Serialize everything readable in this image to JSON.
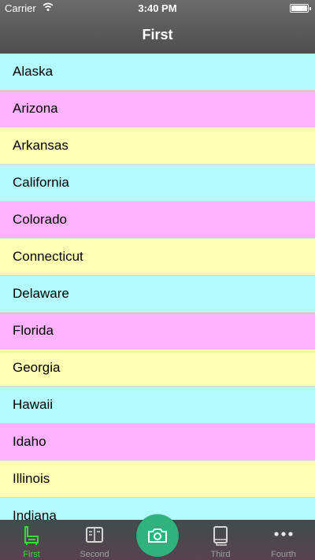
{
  "status": {
    "carrier": "Carrier",
    "time": "3:40 PM",
    "battery_level": 1.0
  },
  "nav": {
    "title": "First"
  },
  "list": {
    "items": [
      "Alaska",
      "Arizona",
      "Arkansas",
      "California",
      "Colorado",
      "Connecticut",
      "Delaware",
      "Florida",
      "Georgia",
      "Hawaii",
      "Idaho",
      "Illinois",
      "Indiana"
    ],
    "row_colors": [
      "#b3fbff",
      "#ffb3ff",
      "#ffffb3"
    ]
  },
  "tabs": [
    {
      "label": "First",
      "icon": "chair-icon",
      "active": true
    },
    {
      "label": "Second",
      "icon": "book-icon",
      "active": false
    },
    {
      "label": "",
      "icon": "camera-icon",
      "active": false
    },
    {
      "label": "Third",
      "icon": "notebook-icon",
      "active": false
    },
    {
      "label": "Fourth",
      "icon": "more-icon",
      "active": false
    }
  ],
  "colors": {
    "accent": "#33dd33",
    "camera": "#2fb27c"
  }
}
